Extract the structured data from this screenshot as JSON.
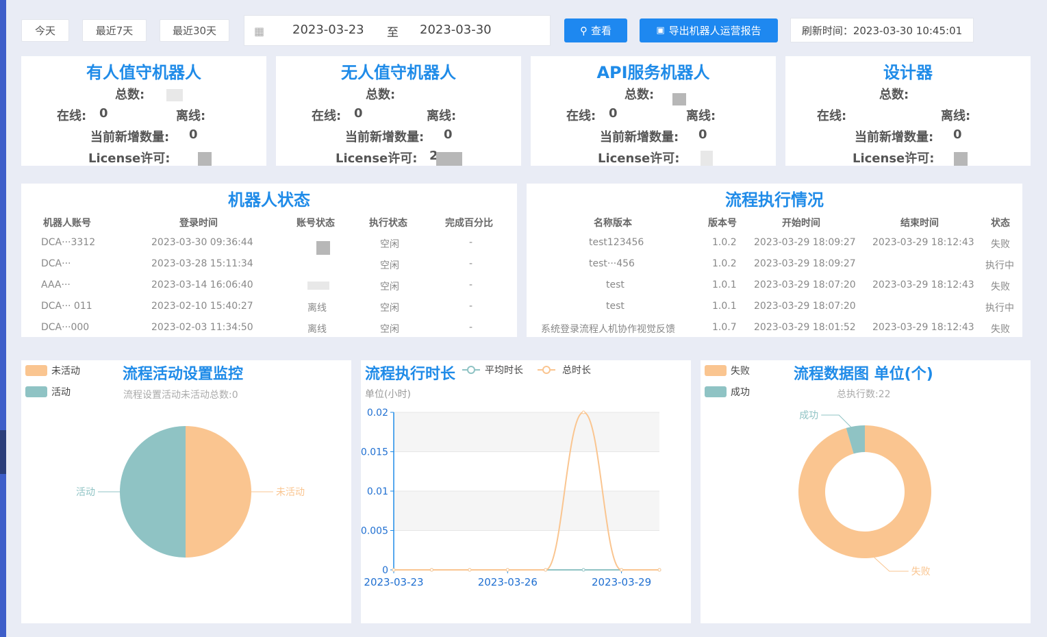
{
  "toolbar": {
    "today_label": "今天",
    "last7_label": "最近7天",
    "last30_label": "最近30天",
    "date_start": "2023-03-23",
    "date_to": "至",
    "date_end": "2023-03-30",
    "query_label": "查看",
    "export_label": "导出机器人运营报告",
    "refresh_text": "刷新时间：2023-03-30 10:45:01"
  },
  "stat_cards": [
    {
      "title": "有人值守机器人",
      "total_label": "总数:",
      "total_value": "",
      "online_label": "在线:",
      "online_value": "0",
      "offline_label": "离线:",
      "offline_value": "",
      "new_label": "当前新增数量:",
      "new_value": "0",
      "license_label": "License许可:",
      "license_value": ""
    },
    {
      "title": "无人值守机器人",
      "total_label": "总数:",
      "total_value": "",
      "online_label": "在线:",
      "online_value": "0",
      "offline_label": "离线:",
      "offline_value": "",
      "new_label": "当前新增数量:",
      "new_value": "0",
      "license_label": "License许可:",
      "license_value": "2"
    },
    {
      "title": "API服务机器人",
      "total_label": "总数:",
      "total_value": "",
      "online_label": "在线:",
      "online_value": "0",
      "offline_label": "离线:",
      "offline_value": "",
      "new_label": "当前新增数量:",
      "new_value": "0",
      "license_label": "License许可:",
      "license_value": ""
    },
    {
      "title": "设计器",
      "total_label": "总数:",
      "total_value": "",
      "online_label": "在线:",
      "online_value": "",
      "offline_label": "离线:",
      "offline_value": "",
      "new_label": "当前新增数量:",
      "new_value": "0",
      "license_label": "License许可:",
      "license_value": ""
    }
  ],
  "robot_status": {
    "title": "机器人状态",
    "columns": [
      "机器人账号",
      "登录时间",
      "账号状态",
      "执行状态",
      "完成百分比"
    ],
    "rows": [
      [
        "DCA···3312",
        "2023-03-30 09:36:44",
        "",
        "空闲",
        "-"
      ],
      [
        "DCA···",
        "2023-03-28 15:11:34",
        "",
        "空闲",
        "-"
      ],
      [
        "AAA···",
        "2023-03-14 16:06:40",
        "",
        "空闲",
        "-"
      ],
      [
        "DCA··· 011",
        "2023-02-10 15:40:27",
        "离线",
        "空闲",
        "-"
      ],
      [
        "DCA···000",
        "2023-02-03 11:34:50",
        "离线",
        "空闲",
        "-"
      ]
    ]
  },
  "process_exec": {
    "title": "流程执行情况",
    "columns": [
      "名称版本",
      "版本号",
      "开始时间",
      "结束时间",
      "状态"
    ],
    "rows": [
      [
        "test123456",
        "1.0.2",
        "2023-03-29 18:09:27",
        "2023-03-29 18:12:43",
        "失败"
      ],
      [
        "test···456",
        "1.0.2",
        "2023-03-29 18:09:27",
        "",
        "执行中"
      ],
      [
        "test",
        "1.0.1",
        "2023-03-29 18:07:20",
        "2023-03-29 18:12:43",
        "失败"
      ],
      [
        "test",
        "1.0.1",
        "2023-03-29 18:07:20",
        "",
        "执行中"
      ],
      [
        "系统登录流程人机协作视觉反馈",
        "1.0.7",
        "2023-03-29 18:01:52",
        "2023-03-29 18:12:43",
        "失败"
      ]
    ]
  },
  "activity_panel": {
    "title": "流程活动设置监控",
    "subtitle": "流程设置活动未活动总数:0",
    "legend": [
      "未活动",
      "活动"
    ]
  },
  "duration_panel": {
    "title": "流程执行时长",
    "legend": [
      "平均时长",
      "总时长"
    ],
    "unit": "单位(小时)"
  },
  "data_panel": {
    "title": "流程数据图 单位(个)",
    "subtitle": "总执行数:22",
    "legend": [
      "失败",
      "成功"
    ]
  },
  "colors": {
    "accent": "#1f8be8",
    "button": "#1e88f0",
    "orange": "#fac590",
    "teal": "#8fc3c4"
  },
  "chart_data": [
    {
      "type": "pie",
      "labels": [
        "未活动",
        "活动"
      ],
      "values": [
        1,
        1
      ],
      "colors": [
        "#fac590",
        "#8fc3c4"
      ]
    },
    {
      "type": "line",
      "x": [
        "2023-03-23",
        "2023-03-24",
        "2023-03-25",
        "2023-03-26",
        "2023-03-27",
        "2023-03-28",
        "2023-03-29",
        "2023-03-30"
      ],
      "xticks": [
        "2023-03-23",
        "2023-03-26",
        "2023-03-29"
      ],
      "series": [
        {
          "name": "平均时长",
          "values": [
            0,
            0,
            0,
            0,
            0,
            0,
            0,
            0
          ],
          "color": "#8fc3c4"
        },
        {
          "name": "总时长",
          "values": [
            0,
            0,
            0,
            0,
            0,
            0.02,
            0,
            0
          ],
          "color": "#fac590"
        }
      ],
      "ylabel": "单位(小时)",
      "ylim": [
        0,
        0.02
      ],
      "yticks": [
        "0",
        "0.005",
        "0.01",
        "0.015",
        "0.02"
      ]
    },
    {
      "type": "pie",
      "labels": [
        "失败",
        "成功"
      ],
      "values": [
        21,
        1
      ],
      "colors": [
        "#fac590",
        "#8fc3c4"
      ]
    }
  ]
}
